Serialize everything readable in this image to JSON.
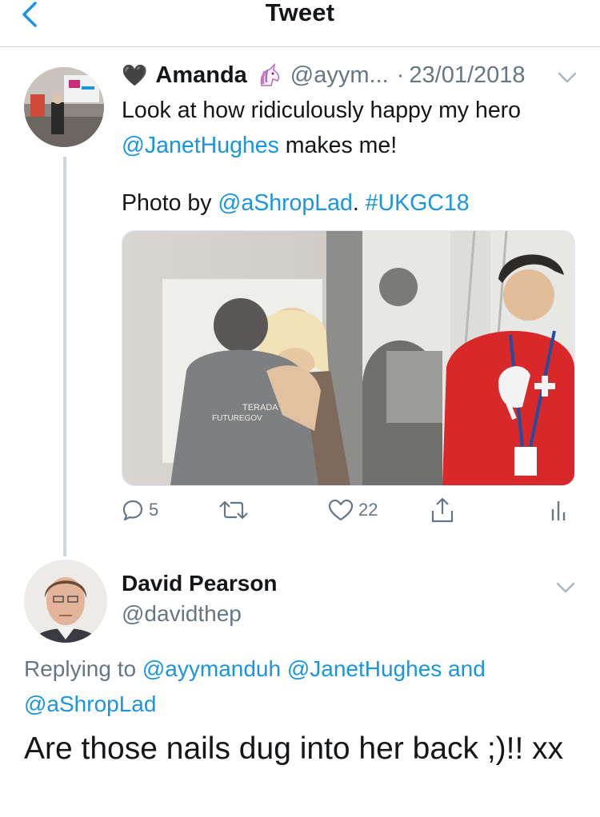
{
  "header": {
    "title": "Tweet",
    "back_icon": "chevron-left-icon"
  },
  "colors": {
    "link": "#1b95e0",
    "muted": "#657786",
    "divider": "#d7dbdf"
  },
  "tweet": {
    "heart_emoji": "🖤",
    "name": "Amanda",
    "name_emoji": "unicorn-icon",
    "handle": "@ayym...",
    "date_sep": "·",
    "date": "23/01/2018",
    "text_line1": "Look at how ridiculously happy my hero",
    "mention_janet": "@JanetHughes",
    "text_line2_rest": " makes me!",
    "photo_by": "Photo by ",
    "mention_shrop": "@aShropLad",
    "period": ".",
    "hashtag": "#UKGC18",
    "actions": {
      "replies": "5",
      "retweets": "",
      "likes": "22"
    }
  },
  "reply": {
    "name": "David Pearson",
    "handle": "@davidthep",
    "replying_to": "Replying to ",
    "mention1": "@ayymanduh",
    "mention2": "@JanetHughes",
    "and": " and",
    "mention3": "@aShropLad",
    "text": "Are those nails dug into her back ;)!! xx"
  }
}
